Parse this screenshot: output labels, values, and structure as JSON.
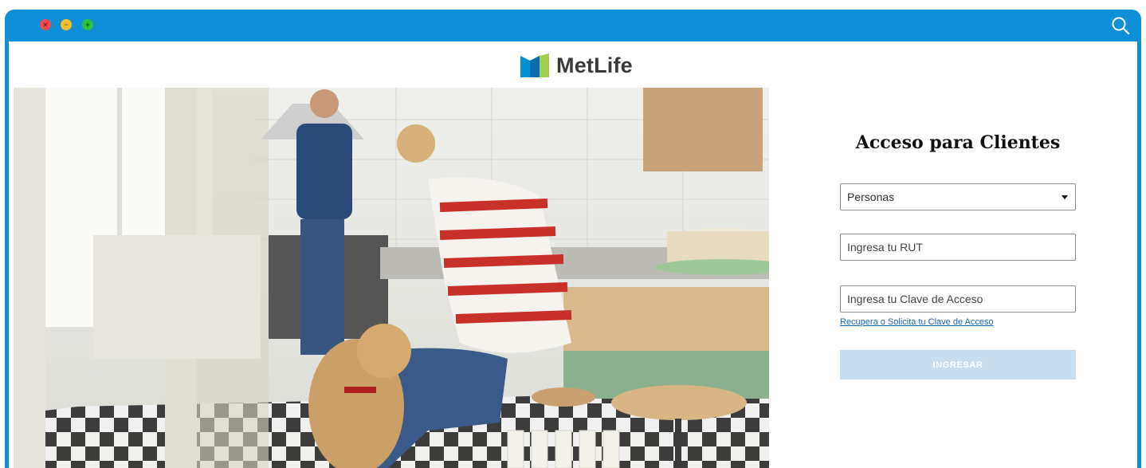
{
  "window": {
    "controls": {
      "close_symbol": "×",
      "minimize_symbol": "−",
      "maximize_symbol": "+"
    },
    "search_icon": "search-icon",
    "accent_color": "#0f8fd6"
  },
  "brand": {
    "name": "MetLife",
    "logo_colors": [
      "#0090da",
      "#a4ce4e"
    ]
  },
  "hero": {
    "image": "kitchen-scene-woman-dog-man"
  },
  "login": {
    "title": "Acceso para Clientes",
    "segment_select": {
      "value": "Personas"
    },
    "rut_input": {
      "placeholder": "Ingresa tu RUT",
      "value": ""
    },
    "password_input": {
      "placeholder": "Ingresa tu Clave de Acceso",
      "value": ""
    },
    "recover_link": "Recupera o Solicita tu Clave de Acceso",
    "submit_label": "INGRESAR",
    "submit_color": "#c7def0"
  }
}
